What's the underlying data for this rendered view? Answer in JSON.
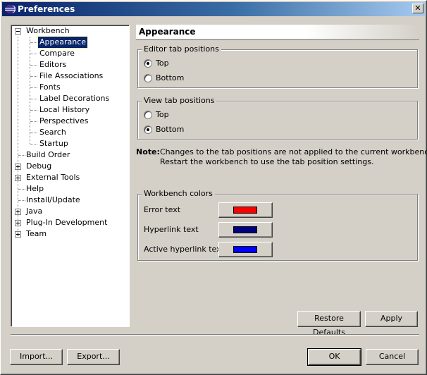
{
  "window": {
    "title": "Preferences",
    "close_glyph": "✕"
  },
  "tree": {
    "items": [
      {
        "label": "Workbench",
        "expander": "minus"
      },
      {
        "label": "Appearance",
        "selected": true
      },
      {
        "label": "Compare"
      },
      {
        "label": "Editors"
      },
      {
        "label": "File Associations"
      },
      {
        "label": "Fonts"
      },
      {
        "label": "Label Decorations"
      },
      {
        "label": "Local History"
      },
      {
        "label": "Perspectives"
      },
      {
        "label": "Search"
      },
      {
        "label": "Startup"
      },
      {
        "label": "Build Order"
      },
      {
        "label": "Debug",
        "expander": "plus"
      },
      {
        "label": "External Tools",
        "expander": "plus"
      },
      {
        "label": "Help"
      },
      {
        "label": "Install/Update"
      },
      {
        "label": "Java",
        "expander": "plus"
      },
      {
        "label": "Plug-In Development",
        "expander": "plus"
      },
      {
        "label": "Team",
        "expander": "plus"
      }
    ]
  },
  "page": {
    "title": "Appearance",
    "editor_tabs": {
      "label": "Editor tab positions",
      "top": "Top",
      "bottom": "Bottom",
      "selected": "Top"
    },
    "view_tabs": {
      "label": "View tab positions",
      "top": "Top",
      "bottom": "Bottom",
      "selected": "Bottom"
    },
    "note": {
      "label": "Note:",
      "line1": "Changes to the tab positions are not applied to the current workbench.",
      "line2": "Restart the workbench to use the tab position settings."
    },
    "colors": {
      "label": "Workbench colors",
      "rows": [
        {
          "label": "Error text",
          "color": "#ff0000"
        },
        {
          "label": "Hyperlink text",
          "color": "#000080"
        },
        {
          "label": "Active hyperlink text",
          "color": "#0000ff"
        }
      ]
    },
    "restore_defaults": "Restore Defaults",
    "apply": "Apply"
  },
  "footer": {
    "import": "Import...",
    "export": "Export...",
    "ok": "OK",
    "cancel": "Cancel"
  }
}
